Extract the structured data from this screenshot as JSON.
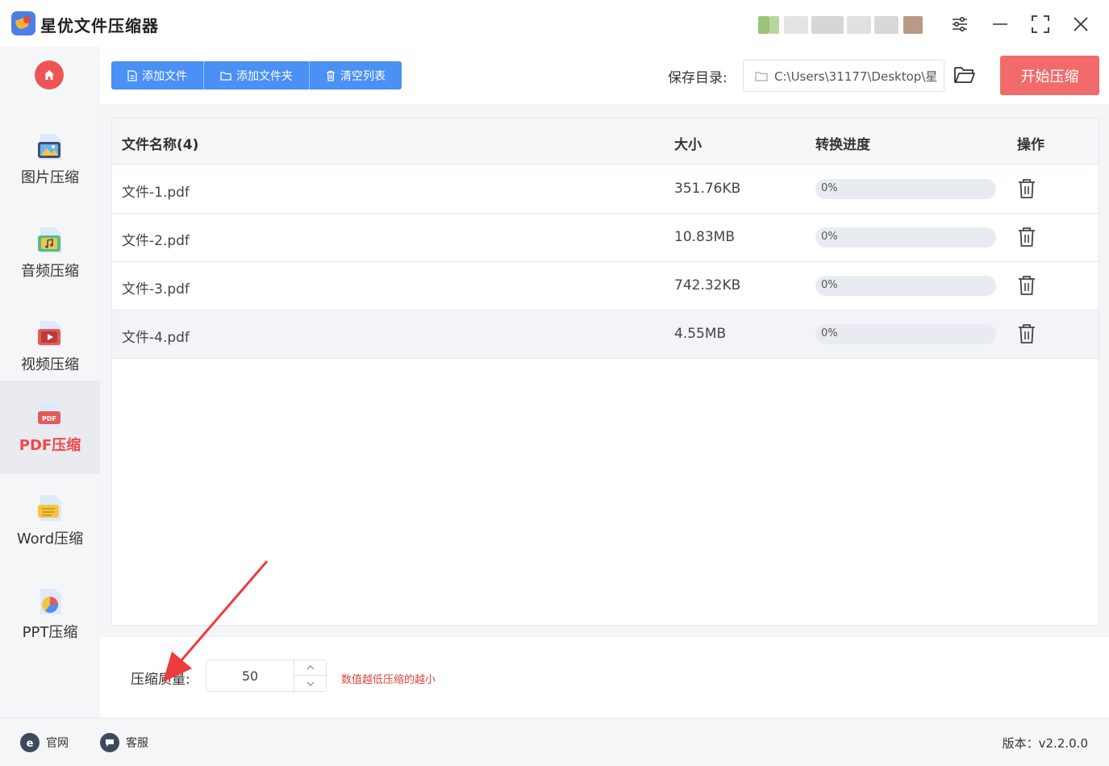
{
  "app": {
    "title": "星优文件压缩器"
  },
  "window_controls": {
    "icons": [
      "settings-sliders-icon",
      "minimize-icon",
      "maximize-icon",
      "close-icon"
    ]
  },
  "sidebar": {
    "items": [
      {
        "label": "图片压缩",
        "icon": "image-compress-icon",
        "active": false
      },
      {
        "label": "音频压缩",
        "icon": "audio-compress-icon",
        "active": false
      },
      {
        "label": "视频压缩",
        "icon": "video-compress-icon",
        "active": false
      },
      {
        "label": "PDF压缩",
        "icon": "pdf-compress-icon",
        "active": true
      },
      {
        "label": "Word压缩",
        "icon": "word-compress-icon",
        "active": false
      },
      {
        "label": "PPT压缩",
        "icon": "ppt-compress-icon",
        "active": false
      }
    ]
  },
  "toolbar": {
    "add_file": "添加文件",
    "add_folder": "添加文件夹",
    "clear_list": "清空列表",
    "save_label": "保存目录:",
    "save_path": "C:\\Users\\31177\\Desktop\\星",
    "start": "开始压缩"
  },
  "table": {
    "headers": {
      "name": "文件名称(4)",
      "size": "大小",
      "progress": "转换进度",
      "action": "操作"
    },
    "rows": [
      {
        "name": "文件-1.pdf",
        "size": "351.76KB",
        "progress": "0%",
        "progress_value": 0
      },
      {
        "name": "文件-2.pdf",
        "size": "10.83MB",
        "progress": "0%",
        "progress_value": 0
      },
      {
        "name": "文件-3.pdf",
        "size": "742.32KB",
        "progress": "0%",
        "progress_value": 0
      },
      {
        "name": "文件-4.pdf",
        "size": "4.55MB",
        "progress": "0%",
        "progress_value": 0
      }
    ]
  },
  "quality": {
    "label": "压缩质量:",
    "value": "50",
    "hint": "数值越低压缩的越小"
  },
  "footer": {
    "website": "官网",
    "support": "客服",
    "version": "版本：v2.2.0.0"
  },
  "colors": {
    "accent_blue": "#4a90f5",
    "accent_red": "#f26b6b",
    "hint_red": "#e0443a"
  }
}
